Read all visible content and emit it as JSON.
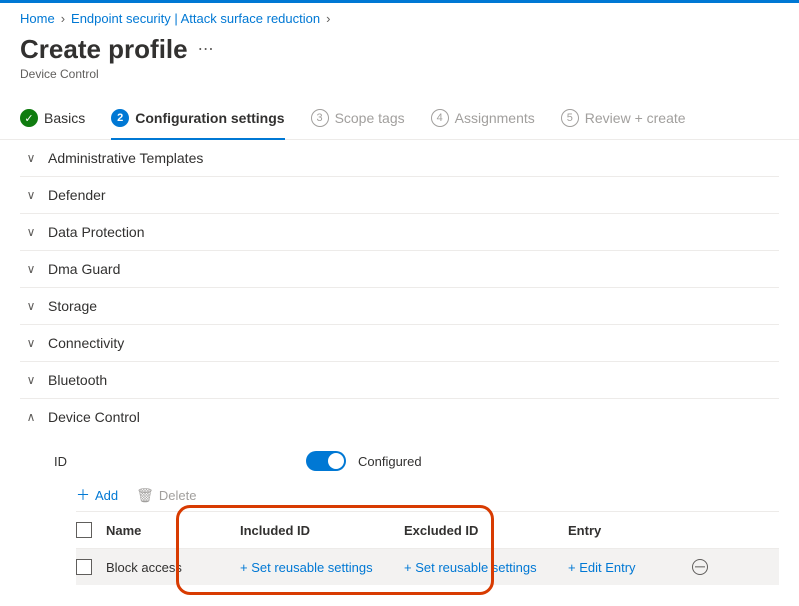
{
  "breadcrumbs": {
    "home": "Home",
    "section": "Endpoint security | Attack surface reduction"
  },
  "page": {
    "title": "Create profile",
    "subtitle": "Device Control"
  },
  "wizard": {
    "s1": "Basics",
    "s2": "Configuration settings",
    "s3": "Scope tags",
    "n3": "3",
    "s4": "Assignments",
    "n4": "4",
    "s5": "Review + create",
    "n5": "5"
  },
  "sections": {
    "admin": "Administrative Templates",
    "defender": "Defender",
    "dataprot": "Data Protection",
    "dma": "Dma Guard",
    "storage": "Storage",
    "conn": "Connectivity",
    "bt": "Bluetooth",
    "dc": "Device Control"
  },
  "dc": {
    "id_label": "ID",
    "toggle_state": "Configured",
    "add": "Add",
    "delete": "Delete",
    "col_name": "Name",
    "col_included": "Included ID",
    "col_excluded": "Excluded ID",
    "col_entry": "Entry",
    "row0": {
      "name": "Block access",
      "included": "+ Set reusable settings",
      "excluded": "+ Set reusable settings",
      "entry": "+ Edit Entry"
    }
  }
}
